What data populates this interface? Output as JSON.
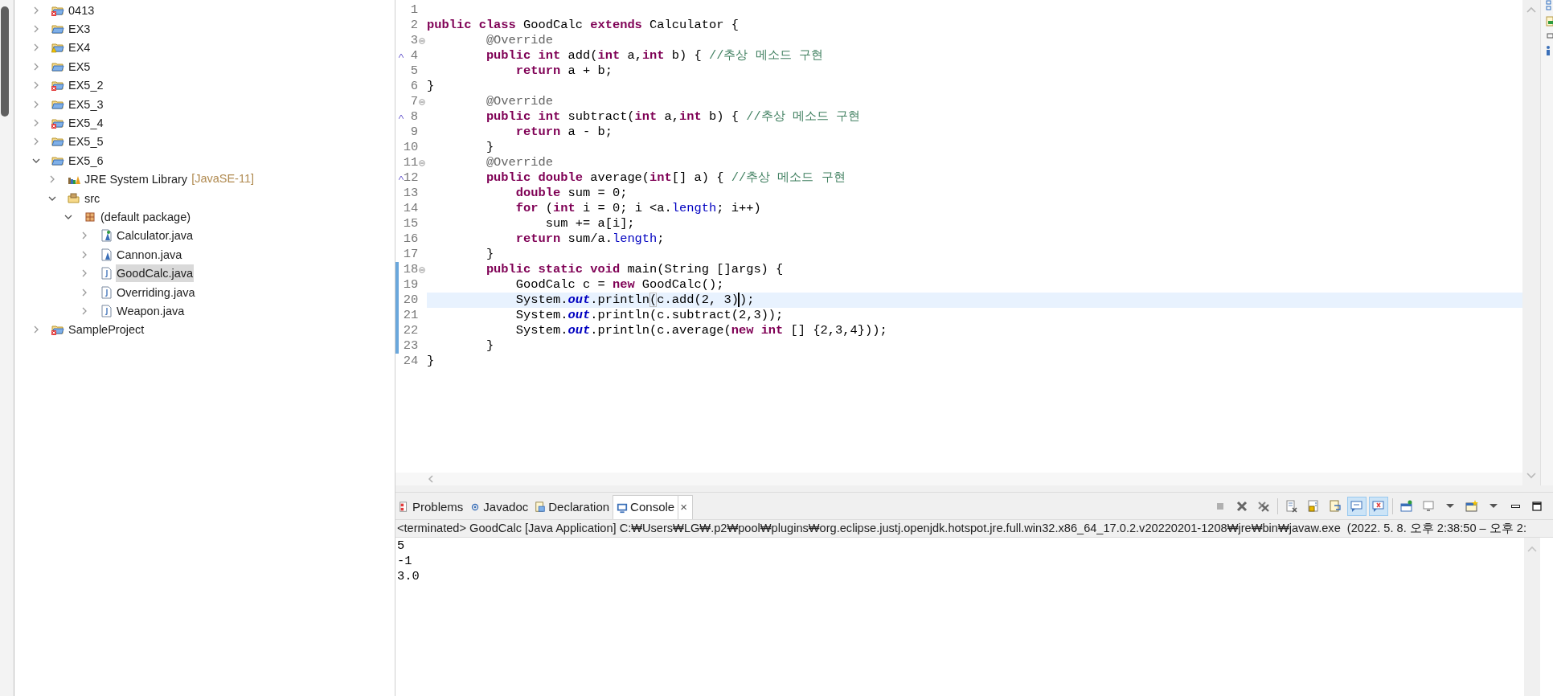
{
  "project_explorer": {
    "items": [
      {
        "label": "0413",
        "kind": "project_error",
        "expanded": false,
        "selected": false
      },
      {
        "label": "EX3",
        "kind": "project",
        "expanded": false,
        "selected": false
      },
      {
        "label": "EX4",
        "kind": "project_warning",
        "expanded": false,
        "selected": false
      },
      {
        "label": "EX5",
        "kind": "project",
        "expanded": false,
        "selected": false
      },
      {
        "label": "EX5_2",
        "kind": "project_error",
        "expanded": false,
        "selected": false
      },
      {
        "label": "EX5_3",
        "kind": "project",
        "expanded": false,
        "selected": false
      },
      {
        "label": "EX5_4",
        "kind": "project_error",
        "expanded": false,
        "selected": false
      },
      {
        "label": "EX5_5",
        "kind": "project",
        "expanded": false,
        "selected": false
      },
      {
        "label": "EX5_6",
        "kind": "project",
        "expanded": true,
        "selected": false,
        "children": [
          {
            "label": "JRE System Library",
            "decoration": "[JavaSE-11]",
            "kind": "library",
            "expanded": false,
            "selected": false
          },
          {
            "label": "src",
            "kind": "source_folder",
            "expanded": true,
            "selected": false,
            "children": [
              {
                "label": "(default package)",
                "kind": "package",
                "expanded": true,
                "selected": false,
                "children": [
                  {
                    "label": "Calculator.java",
                    "kind": "java_abstract",
                    "expanded": false,
                    "selected": false
                  },
                  {
                    "label": "Cannon.java",
                    "kind": "java_class",
                    "expanded": false,
                    "selected": false
                  },
                  {
                    "label": "GoodCalc.java",
                    "kind": "java_file",
                    "expanded": false,
                    "selected": true
                  },
                  {
                    "label": "Overriding.java",
                    "kind": "java_file",
                    "expanded": false,
                    "selected": false
                  },
                  {
                    "label": "Weapon.java",
                    "kind": "java_file",
                    "expanded": false,
                    "selected": false
                  }
                ]
              }
            ]
          }
        ]
      },
      {
        "label": "SampleProject",
        "kind": "project_error",
        "expanded": false,
        "selected": false
      }
    ]
  },
  "editor": {
    "lines": [
      {
        "number": "1",
        "fold": false,
        "override": false,
        "changed": false,
        "current": false
      },
      {
        "number": "2",
        "tokens": [
          {
            "kind": "keyword",
            "text": "public class"
          },
          {
            "kind": "plain",
            "text": " GoodCalc "
          },
          {
            "kind": "keyword",
            "text": "extends"
          },
          {
            "kind": "plain",
            "text": " Calculator {"
          }
        ],
        "fold": false,
        "override": false,
        "changed": false,
        "current": false
      },
      {
        "number": "3",
        "tokens": [
          {
            "kind": "annotation",
            "text": "        @Override"
          }
        ],
        "fold": true,
        "override": false,
        "changed": false,
        "current": false
      },
      {
        "number": "4",
        "tokens": [
          {
            "kind": "keyword",
            "text": "        public int"
          },
          {
            "kind": "plain",
            "text": " add("
          },
          {
            "kind": "keyword",
            "text": "int"
          },
          {
            "kind": "plain",
            "text": " a,"
          },
          {
            "kind": "keyword",
            "text": "int"
          },
          {
            "kind": "plain",
            "text": " b) { "
          },
          {
            "kind": "comment",
            "text": "//추상 메소드 구현"
          }
        ],
        "fold": false,
        "override": true,
        "changed": false,
        "current": false
      },
      {
        "number": "5",
        "tokens": [
          {
            "kind": "keyword",
            "text": "            return"
          },
          {
            "kind": "plain",
            "text": " a + b;"
          }
        ],
        "fold": false,
        "override": false,
        "changed": false,
        "current": false
      },
      {
        "number": "6",
        "tokens": [
          {
            "kind": "plain",
            "text": "}"
          }
        ],
        "fold": false,
        "override": false,
        "changed": false,
        "current": false
      },
      {
        "number": "7",
        "tokens": [
          {
            "kind": "annotation",
            "text": "        @Override"
          }
        ],
        "fold": true,
        "override": false,
        "changed": false,
        "current": false
      },
      {
        "number": "8",
        "tokens": [
          {
            "kind": "keyword",
            "text": "        public int"
          },
          {
            "kind": "plain",
            "text": " subtract("
          },
          {
            "kind": "keyword",
            "text": "int"
          },
          {
            "kind": "plain",
            "text": " a,"
          },
          {
            "kind": "keyword",
            "text": "int"
          },
          {
            "kind": "plain",
            "text": " b) { "
          },
          {
            "kind": "comment",
            "text": "//추상 메소드 구현"
          }
        ],
        "fold": false,
        "override": true,
        "changed": false,
        "current": false
      },
      {
        "number": "9",
        "tokens": [
          {
            "kind": "keyword",
            "text": "            return"
          },
          {
            "kind": "plain",
            "text": " a - b;"
          }
        ],
        "fold": false,
        "override": false,
        "changed": false,
        "current": false
      },
      {
        "number": "10",
        "tokens": [
          {
            "kind": "plain",
            "text": "        }"
          }
        ],
        "fold": false,
        "override": false,
        "changed": false,
        "current": false
      },
      {
        "number": "11",
        "tokens": [
          {
            "kind": "annotation",
            "text": "        @Override"
          }
        ],
        "fold": true,
        "override": false,
        "changed": false,
        "current": false
      },
      {
        "number": "12",
        "tokens": [
          {
            "kind": "keyword",
            "text": "        public double"
          },
          {
            "kind": "plain",
            "text": " average("
          },
          {
            "kind": "keyword",
            "text": "int"
          },
          {
            "kind": "plain",
            "text": "[] a) { "
          },
          {
            "kind": "comment",
            "text": "//추상 메소드 구현"
          }
        ],
        "fold": false,
        "override": true,
        "changed": false,
        "current": false
      },
      {
        "number": "13",
        "tokens": [
          {
            "kind": "keyword",
            "text": "            double"
          },
          {
            "kind": "plain",
            "text": " sum = 0;"
          }
        ],
        "fold": false,
        "override": false,
        "changed": false,
        "current": false
      },
      {
        "number": "14",
        "tokens": [
          {
            "kind": "keyword",
            "text": "            for"
          },
          {
            "kind": "plain",
            "text": " ("
          },
          {
            "kind": "keyword",
            "text": "int"
          },
          {
            "kind": "plain",
            "text": " i = 0; i <a."
          },
          {
            "kind": "field",
            "text": "length"
          },
          {
            "kind": "plain",
            "text": "; i++)"
          }
        ],
        "fold": false,
        "override": false,
        "changed": false,
        "current": false
      },
      {
        "number": "15",
        "tokens": [
          {
            "kind": "plain",
            "text": "                sum += a[i];"
          }
        ],
        "fold": false,
        "override": false,
        "changed": false,
        "current": false
      },
      {
        "number": "16",
        "tokens": [
          {
            "kind": "keyword",
            "text": "            return"
          },
          {
            "kind": "plain",
            "text": " sum/a."
          },
          {
            "kind": "field",
            "text": "length"
          },
          {
            "kind": "plain",
            "text": ";"
          }
        ],
        "fold": false,
        "override": false,
        "changed": false,
        "current": false
      },
      {
        "number": "17",
        "tokens": [
          {
            "kind": "plain",
            "text": "        }"
          }
        ],
        "fold": false,
        "override": false,
        "changed": false,
        "current": false
      },
      {
        "number": "18",
        "tokens": [
          {
            "kind": "keyword",
            "text": "        public static void"
          },
          {
            "kind": "plain",
            "text": " main(String []args) {"
          }
        ],
        "fold": true,
        "override": false,
        "changed": true,
        "current": false
      },
      {
        "number": "19",
        "tokens": [
          {
            "kind": "plain",
            "text": "            GoodCalc c = "
          },
          {
            "kind": "keyword",
            "text": "new"
          },
          {
            "kind": "plain",
            "text": " GoodCalc();"
          }
        ],
        "fold": false,
        "override": false,
        "changed": true,
        "current": false
      },
      {
        "number": "20",
        "tokens": [
          {
            "kind": "plain",
            "text": "            System."
          },
          {
            "kind": "static_field",
            "text": "out"
          },
          {
            "kind": "plain",
            "text": ".println"
          },
          {
            "kind": "matched_bracket",
            "text": "("
          },
          {
            "kind": "plain",
            "text": "c.add(2, 3)"
          },
          {
            "kind": "caret",
            "text": ")"
          },
          {
            "kind": "plain",
            "text": ";"
          }
        ],
        "fold": false,
        "override": false,
        "changed": true,
        "current": true
      },
      {
        "number": "21",
        "tokens": [
          {
            "kind": "plain",
            "text": "            System."
          },
          {
            "kind": "static_field",
            "text": "out"
          },
          {
            "kind": "plain",
            "text": ".println(c.subtract(2,3));"
          }
        ],
        "fold": false,
        "override": false,
        "changed": true,
        "current": false
      },
      {
        "number": "22",
        "tokens": [
          {
            "kind": "plain",
            "text": "            System."
          },
          {
            "kind": "static_field",
            "text": "out"
          },
          {
            "kind": "plain",
            "text": ".println(c.average("
          },
          {
            "kind": "keyword",
            "text": "new int"
          },
          {
            "kind": "plain",
            "text": " [] {2,3,4}));"
          }
        ],
        "fold": false,
        "override": false,
        "changed": true,
        "current": false
      },
      {
        "number": "23",
        "tokens": [
          {
            "kind": "plain",
            "text": "        }"
          }
        ],
        "fold": false,
        "override": false,
        "changed": true,
        "current": false
      },
      {
        "number": "24",
        "tokens": [
          {
            "kind": "plain",
            "text": "}"
          }
        ],
        "fold": false,
        "override": false,
        "changed": false,
        "current": false
      }
    ]
  },
  "console_view": {
    "tabs": [
      {
        "label": "Problems",
        "kind": "problems",
        "selected": false
      },
      {
        "label": "Javadoc",
        "kind": "javadoc",
        "selected": false
      },
      {
        "label": "Declaration",
        "kind": "declaration",
        "selected": false
      },
      {
        "label": "Console",
        "kind": "console",
        "selected": true,
        "close": "×"
      }
    ],
    "toolbar": [
      {
        "kind": "terminate",
        "pressed": false
      },
      {
        "kind": "remove",
        "pressed": false
      },
      {
        "kind": "remove_all",
        "pressed": false
      },
      {
        "kind": "separator"
      },
      {
        "kind": "clear",
        "pressed": false
      },
      {
        "kind": "scroll_lock",
        "pressed": false
      },
      {
        "kind": "word_wrap",
        "pressed": false
      },
      {
        "kind": "stdout",
        "pressed": true
      },
      {
        "kind": "stderr",
        "pressed": true
      },
      {
        "kind": "separator"
      },
      {
        "kind": "pin",
        "pressed": false
      },
      {
        "kind": "display",
        "pressed": false
      },
      {
        "kind": "dropdown",
        "pressed": false
      },
      {
        "kind": "open_console",
        "pressed": false
      },
      {
        "kind": "dropdown",
        "pressed": false
      },
      {
        "kind": "minimize",
        "pressed": false
      },
      {
        "kind": "maximize",
        "pressed": false
      }
    ],
    "process_label": "<terminated> GoodCalc [Java Application] C:₩Users₩LG₩.p2₩pool₩plugins₩org.eclipse.justj.openjdk.hotspot.jre.full.win32.x86_64_17.0.2.v20220201-1208₩jre₩bin₩javaw.exe  (2022. 5. 8. 오후 2:38:50 – 오후 2:",
    "output": [
      "5",
      "-1",
      "3.0"
    ]
  }
}
